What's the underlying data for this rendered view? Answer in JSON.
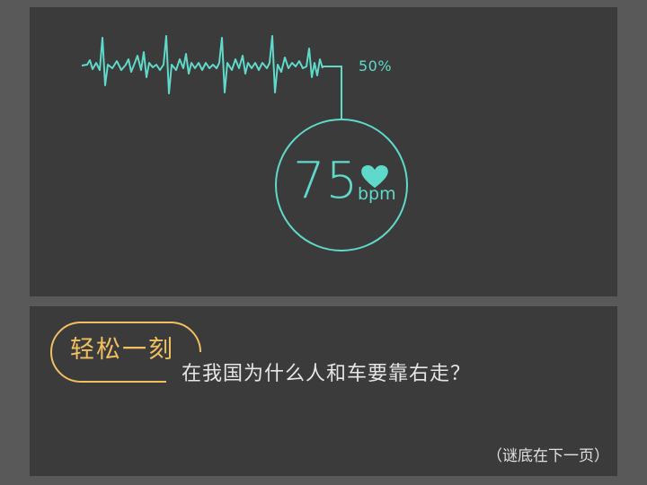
{
  "monitor": {
    "percent": "50%",
    "heart_rate": "75",
    "unit": "bpm",
    "accent_color": "#5fd9c9",
    "icon": "heart-icon"
  },
  "quiz": {
    "tag": "轻松一刻",
    "question": "在我国为什么人和车要靠右走？",
    "answer_note": "（谜底在下一页）",
    "tag_color": "#f0c060"
  }
}
